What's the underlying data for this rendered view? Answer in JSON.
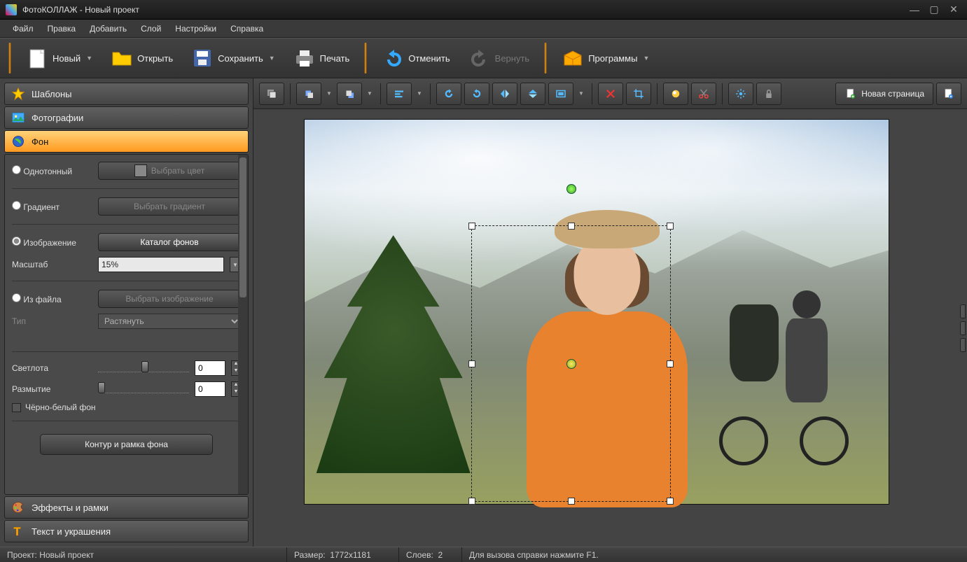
{
  "title": "ФотоКОЛЛАЖ - Новый проект",
  "menu": [
    "Файл",
    "Правка",
    "Добавить",
    "Слой",
    "Настройки",
    "Справка"
  ],
  "toolbar": {
    "new": "Новый",
    "open": "Открыть",
    "save": "Сохранить",
    "print": "Печать",
    "undo": "Отменить",
    "redo": "Вернуть",
    "programs": "Программы"
  },
  "sidebar": {
    "templates": "Шаблоны",
    "photos": "Фотографии",
    "background": "Фон",
    "effects": "Эффекты и рамки",
    "text": "Текст и украшения"
  },
  "bgpanel": {
    "solid": "Однотонный",
    "choose_color": "Выбрать цвет",
    "gradient": "Градиент",
    "choose_gradient": "Выбрать градиент",
    "image": "Изображение",
    "catalog": "Каталог фонов",
    "scale_label": "Масштаб",
    "scale_value": "15%",
    "from_file": "Из файла",
    "choose_image": "Выбрать изображение",
    "type_label": "Тип",
    "type_value": "Растянуть",
    "brightness": "Светлота",
    "brightness_val": "0",
    "blur": "Размытие",
    "blur_val": "0",
    "bw": "Чёрно-белый фон",
    "contour": "Контур и рамка фона"
  },
  "canvasbar": {
    "new_page": "Новая страница"
  },
  "status": {
    "project_label": "Проект:",
    "project_name": "Новый проект",
    "size_label": "Размер:",
    "size_value": "1772x1181",
    "layers_label": "Слоев:",
    "layers_value": "2",
    "help": "Для вызова справки нажмите F1."
  }
}
